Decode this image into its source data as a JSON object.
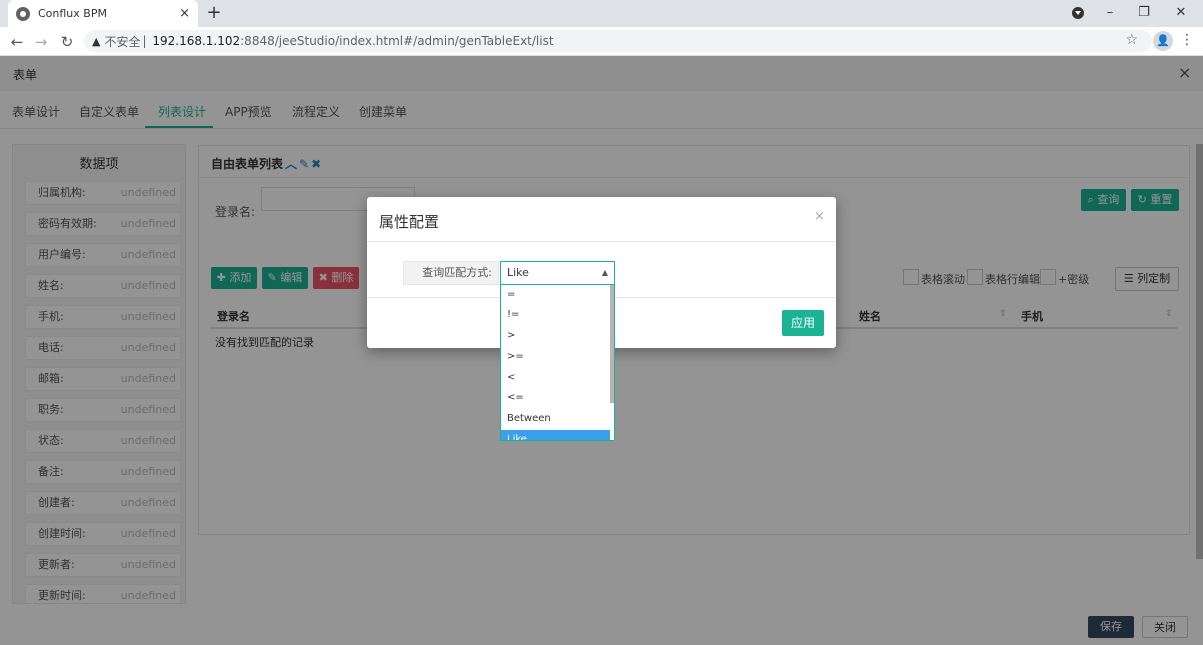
{
  "browser": {
    "tab_title": "Conflux BPM",
    "tab_close": "×",
    "new_tab": "+",
    "insecure_label": "不安全",
    "url_host": "192.168.1.102",
    "url_path": ":8848/jeeStudio/index.html#/admin/genTableExt/list"
  },
  "form": {
    "title": "表单",
    "close": "×"
  },
  "nav": {
    "tabs": [
      "表单设计",
      "自定义表单",
      "列表设计",
      "APP预览",
      "流程定义",
      "创建菜单"
    ],
    "active_index": 2
  },
  "sidebar": {
    "title": "数据项",
    "items": [
      {
        "label": "归属机构:",
        "value": "undefined"
      },
      {
        "label": "密码有效期:",
        "value": "undefined"
      },
      {
        "label": "用户编号:",
        "value": "undefined"
      },
      {
        "label": "姓名:",
        "value": "undefined"
      },
      {
        "label": "手机:",
        "value": "undefined"
      },
      {
        "label": "电话:",
        "value": "undefined"
      },
      {
        "label": "邮箱:",
        "value": "undefined"
      },
      {
        "label": "职务:",
        "value": "undefined"
      },
      {
        "label": "状态:",
        "value": "undefined"
      },
      {
        "label": "备注:",
        "value": "undefined"
      },
      {
        "label": "创建者:",
        "value": "undefined"
      },
      {
        "label": "创建时间:",
        "value": "undefined"
      },
      {
        "label": "更新者:",
        "value": "undefined"
      },
      {
        "label": "更新时间:",
        "value": "undefined"
      }
    ]
  },
  "main": {
    "title": "自由表单列表",
    "search_label": "登录名:",
    "query_button": "查询",
    "reset_button": "重置",
    "add_button": "添加",
    "edit_button": "编辑",
    "delete_button": "删除",
    "toggle_scroll": "表格滚动",
    "toggle_row_edit": "表格行编辑",
    "toggle_dense": "+密级",
    "column_customize": "列定制",
    "columns": [
      "登录名",
      "姓名",
      "手机"
    ],
    "empty_text": "没有找到匹配的记录"
  },
  "footer": {
    "save": "保存",
    "close": "关闭"
  },
  "modal": {
    "title": "属性配置",
    "field_label": "查询匹配方式:",
    "selected": "Like",
    "apply": "应用",
    "options": [
      "=",
      "!=",
      ">",
      ">=",
      "<",
      "<=",
      "Between",
      "Like"
    ]
  },
  "colors": {
    "primary": "#1ab394",
    "info": "#1c84c6",
    "danger": "#ed5565",
    "selected_option": "#3aa0ec"
  }
}
